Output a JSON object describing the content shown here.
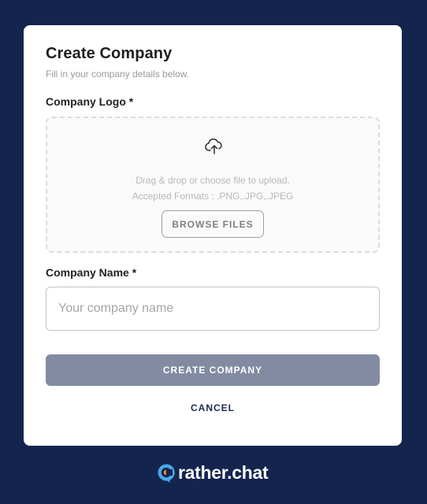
{
  "form": {
    "title": "Create Company",
    "subtitle": "Fill in your company details below.",
    "logo_label": "Company Logo *",
    "dropzone": {
      "icon": "cloud-upload-icon",
      "line1": "Drag & drop or choose file to upload.",
      "line2": "Accepted Formats : .PNG,.JPG,.JPEG",
      "browse_label": "BROWSE FILES"
    },
    "name_label": "Company Name *",
    "name_input": {
      "value": "",
      "placeholder": "Your company name"
    },
    "create_label": "CREATE COMPANY",
    "cancel_label": "CANCEL"
  },
  "brand": {
    "name": "rather.chat",
    "icon": "rather-chat-logo-icon"
  },
  "colors": {
    "background": "#13254f",
    "card": "#ffffff",
    "primary_disabled": "#838ba2",
    "cancel_text": "#1a2b52",
    "brand_accent_orange": "#f07a2e",
    "brand_accent_blue": "#4aa8e8"
  }
}
